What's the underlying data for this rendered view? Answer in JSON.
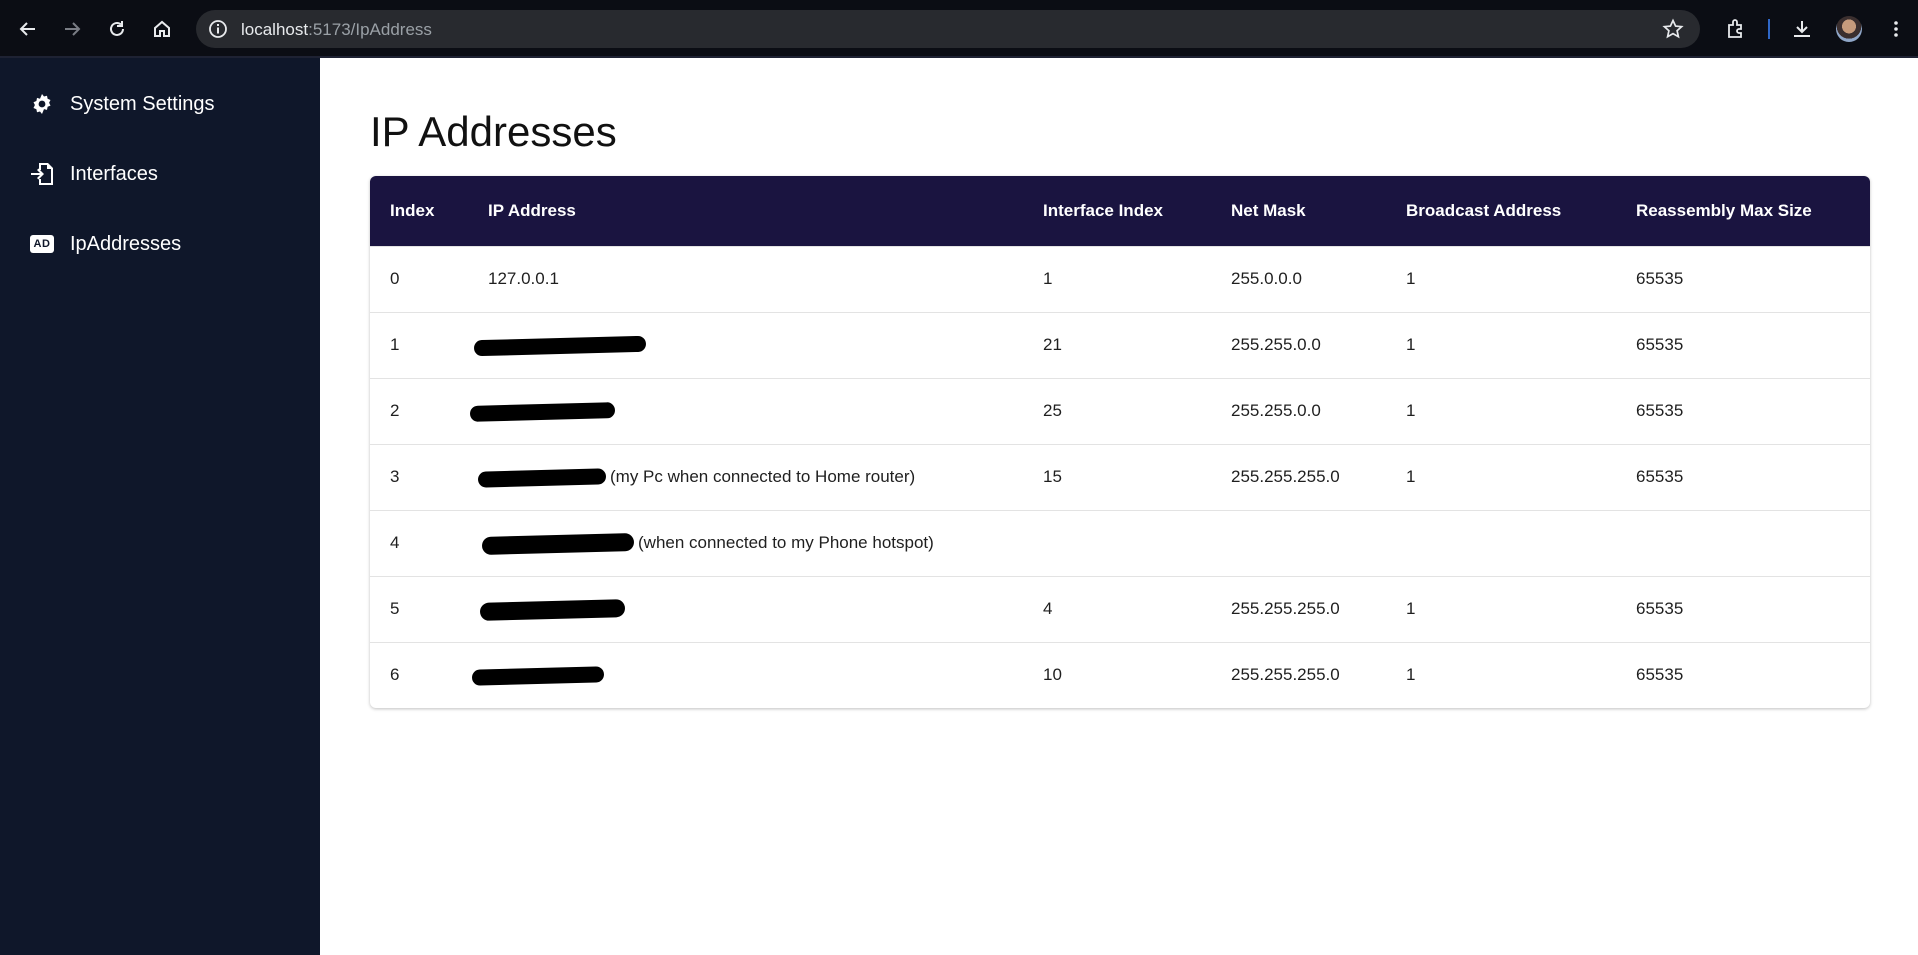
{
  "browser": {
    "url_host": "localhost",
    "url_path": ":5173/IpAddress"
  },
  "sidebar": {
    "items": [
      {
        "label": "System Settings",
        "icon": "gear-icon"
      },
      {
        "label": "Interfaces",
        "icon": "interfaces-icon"
      },
      {
        "label": "IpAddresses",
        "icon": "ad-badge-icon",
        "badge": "AD"
      }
    ]
  },
  "main": {
    "title": "IP Addresses",
    "table": {
      "columns": [
        "Index",
        "IP Address",
        "Interface Index",
        "Net Mask",
        "Broadcast Address",
        "Reassembly Max Size"
      ],
      "rows": [
        {
          "index": "0",
          "ip": "127.0.0.1",
          "ip_redacted": false,
          "if_index": "1",
          "netmask": "255.0.0.0",
          "broadcast": "1",
          "reasm": "65535"
        },
        {
          "index": "1",
          "ip": "",
          "ip_redacted": true,
          "if_index": "21",
          "netmask": "255.255.0.0",
          "broadcast": "1",
          "reasm": "65535"
        },
        {
          "index": "2",
          "ip": "",
          "ip_redacted": true,
          "if_index": "25",
          "netmask": "255.255.0.0",
          "broadcast": "1",
          "reasm": "65535"
        },
        {
          "index": "3",
          "ip": "(my Pc when connected to Home router)",
          "ip_redacted": true,
          "if_index": "15",
          "netmask": "255.255.255.0",
          "broadcast": "1",
          "reasm": "65535"
        },
        {
          "index": "4",
          "ip": "(when connected to my Phone hotspot)",
          "ip_redacted": true,
          "if_index": "",
          "netmask": "",
          "broadcast": "",
          "reasm": ""
        },
        {
          "index": "5",
          "ip": "",
          "ip_redacted": true,
          "if_index": "4",
          "netmask": "255.255.255.0",
          "broadcast": "1",
          "reasm": "65535"
        },
        {
          "index": "6",
          "ip": "",
          "ip_redacted": true,
          "if_index": "10",
          "netmask": "255.255.255.0",
          "broadcast": "1",
          "reasm": "65535"
        }
      ]
    }
  },
  "colors": {
    "sidebar_bg": "#0f172a",
    "table_header_bg": "#1a1440",
    "browser_bg": "#0b0d14"
  }
}
